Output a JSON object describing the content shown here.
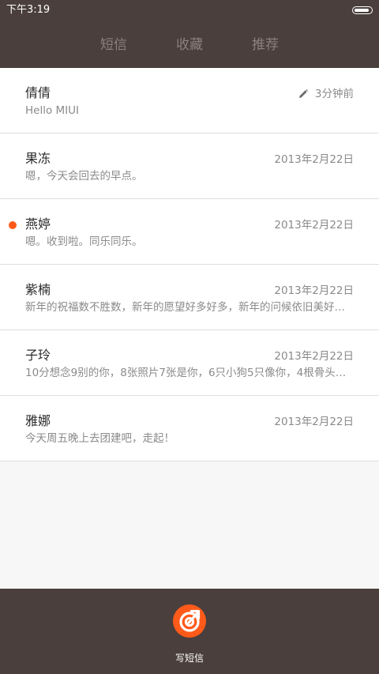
{
  "status_bar": {
    "time": "下午3:19",
    "battery_level": 0.9
  },
  "tabs": [
    {
      "label": "短信",
      "active": true
    },
    {
      "label": "收藏",
      "active": false
    },
    {
      "label": "推荐",
      "active": false
    }
  ],
  "conversations": [
    {
      "name": "倩倩",
      "preview": "Hello MIUI",
      "date": "3分钟前",
      "draft": true,
      "unread": false
    },
    {
      "name": "果冻",
      "preview": "嗯，今天会回去的早点。",
      "date": "2013年2月22日",
      "draft": false,
      "unread": false
    },
    {
      "name": "燕婷",
      "preview": "嗯。收到啦。同乐同乐。",
      "date": "2013年2月22日",
      "draft": false,
      "unread": true
    },
    {
      "name": "紫楠",
      "preview": "新年的祝福数不胜数，新年的愿望好多好多，新年的问候依旧美好…",
      "date": "2013年2月22日",
      "draft": false,
      "unread": false
    },
    {
      "name": "子玲",
      "preview": "10分想念9别的你，8张照片7张是你，6只小狗5只像你，4根骨头…",
      "date": "2013年2月22日",
      "draft": false,
      "unread": false
    },
    {
      "name": "雅娜",
      "preview": "今天周五晚上去团建吧，走起！",
      "date": "2013年2月22日",
      "draft": false,
      "unread": false
    }
  ],
  "bottom_bar": {
    "compose_label": "写短信",
    "compose_icon": "compose-icon"
  },
  "colors": {
    "bar": "#4a3f3c",
    "accent": "#ff5a1a",
    "unread": "#ff5a1a"
  }
}
